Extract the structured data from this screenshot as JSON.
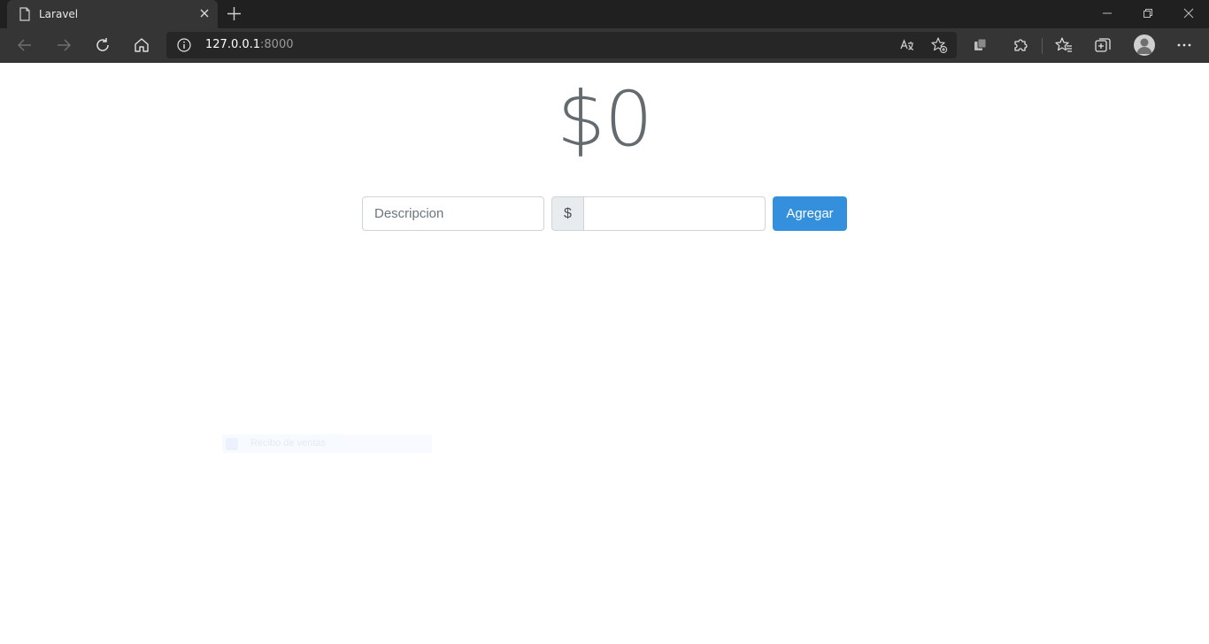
{
  "browser": {
    "tab_title": "Laravel",
    "address_host": "127.0.0.1",
    "address_port": ":8000",
    "icons": {
      "back": "arrow-left-icon",
      "forward": "arrow-right-icon",
      "refresh": "refresh-icon",
      "home": "home-icon",
      "site_info": "info-icon",
      "read_aloud": "translate-icon",
      "favorite_add": "star-plus-icon",
      "collections": "collections-icon",
      "extensions": "puzzle-icon",
      "favorites": "favorites-icon",
      "tab_actions": "tab-actions-icon",
      "profile": "profile-icon",
      "menu": "more-icon"
    }
  },
  "page": {
    "total": "$0",
    "description_placeholder": "Descripcion",
    "amount_prefix": "$",
    "amount_value": "",
    "add_button": "Agregar",
    "ghost_text": "Recibo de ventas"
  },
  "colors": {
    "accent": "#3490dc",
    "total_text": "#636b6f"
  }
}
